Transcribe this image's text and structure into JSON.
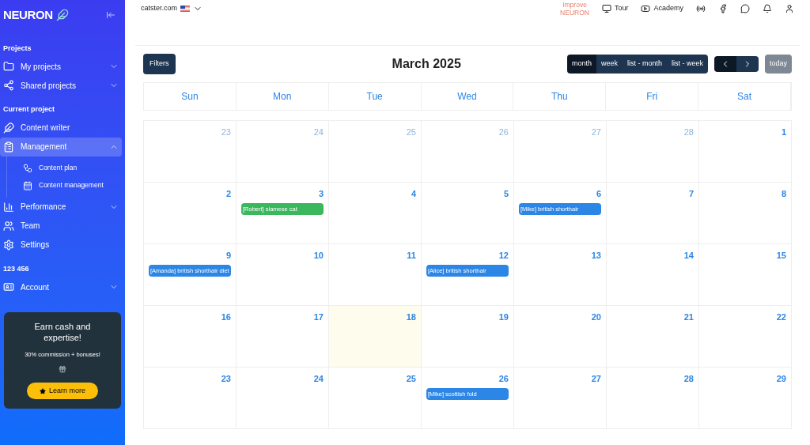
{
  "sidebar": {
    "logo": "NEURON",
    "groups": [
      {
        "heading": "Projects",
        "items": [
          {
            "label": "My projects",
            "expanded": false,
            "selected": false
          },
          {
            "label": "Shared projects",
            "expanded": false,
            "selected": false
          }
        ]
      },
      {
        "heading": "Current project",
        "items": [
          {
            "label": "Content writer",
            "selected": false
          },
          {
            "label": "Management",
            "expanded": true,
            "selected": true,
            "children": [
              {
                "label": "Content plan"
              },
              {
                "label": "Content management"
              }
            ]
          },
          {
            "label": "Performance",
            "expanded": false,
            "selected": false
          },
          {
            "label": "Team",
            "selected": false
          },
          {
            "label": "Settings",
            "selected": false
          }
        ]
      },
      {
        "heading": "123 456",
        "items": [
          {
            "label": "Account",
            "expanded": false,
            "selected": false
          }
        ]
      }
    ],
    "promo": {
      "title": "Earn cash and expertise!",
      "subtitle": "30% commission + bonuses!",
      "button": "Learn more"
    }
  },
  "topbar": {
    "site": "catster.com",
    "improve": [
      "Improve",
      "NEURON"
    ],
    "links": [
      "Tour",
      "Academy"
    ]
  },
  "calendar": {
    "filters": "Filters",
    "title": "March 2025",
    "views": [
      {
        "label": "month",
        "selected": true
      },
      {
        "label": "week",
        "selected": false
      },
      {
        "label": "list - month",
        "selected": false
      },
      {
        "label": "list - week",
        "selected": false
      }
    ],
    "today": "today",
    "weekdays": [
      "Sun",
      "Mon",
      "Tue",
      "Wed",
      "Thu",
      "Fri",
      "Sat"
    ],
    "weeks": [
      [
        {
          "day": "23",
          "muted": true
        },
        {
          "day": "24",
          "muted": true
        },
        {
          "day": "25",
          "muted": true
        },
        {
          "day": "26",
          "muted": true
        },
        {
          "day": "27",
          "muted": true
        },
        {
          "day": "28",
          "muted": true
        },
        {
          "day": "1",
          "muted": false
        }
      ],
      [
        {
          "day": "2",
          "muted": false
        },
        {
          "day": "3",
          "muted": false,
          "events": [
            {
              "label": "[Robert] siamese cat",
              "color": "#3bb75e"
            }
          ]
        },
        {
          "day": "4",
          "muted": false
        },
        {
          "day": "5",
          "muted": false
        },
        {
          "day": "6",
          "muted": false,
          "events": [
            {
              "label": "[Mike] british shorthair",
              "color": "#2c86e6"
            }
          ]
        },
        {
          "day": "7",
          "muted": false
        },
        {
          "day": "8",
          "muted": false
        }
      ],
      [
        {
          "day": "9",
          "muted": false,
          "events": [
            {
              "label": "[Amanda] british shorthair diet",
              "color": "#2c86e6"
            }
          ]
        },
        {
          "day": "10",
          "muted": false
        },
        {
          "day": "11",
          "muted": false
        },
        {
          "day": "12",
          "muted": false,
          "events": [
            {
              "label": "[Alice] british shorthair",
              "color": "#2c86e6"
            }
          ]
        },
        {
          "day": "13",
          "muted": false
        },
        {
          "day": "14",
          "muted": false
        },
        {
          "day": "15",
          "muted": false
        }
      ],
      [
        {
          "day": "16",
          "muted": false
        },
        {
          "day": "17",
          "muted": false
        },
        {
          "day": "18",
          "muted": false,
          "today": true
        },
        {
          "day": "19",
          "muted": false
        },
        {
          "day": "20",
          "muted": false
        },
        {
          "day": "21",
          "muted": false
        },
        {
          "day": "22",
          "muted": false
        }
      ],
      [
        {
          "day": "23",
          "muted": false
        },
        {
          "day": "24",
          "muted": false
        },
        {
          "day": "25",
          "muted": false
        },
        {
          "day": "26",
          "muted": false,
          "events": [
            {
              "label": "[Mike] scottish fold",
              "color": "#2c86e6"
            }
          ]
        },
        {
          "day": "27",
          "muted": false
        },
        {
          "day": "28",
          "muted": false
        },
        {
          "day": "29",
          "muted": false
        }
      ]
    ]
  }
}
